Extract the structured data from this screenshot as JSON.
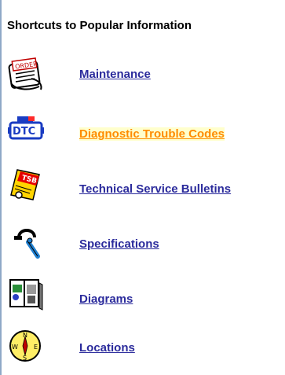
{
  "heading": "Shortcuts to Popular Information",
  "items": [
    {
      "label": "Maintenance",
      "icon": "order-clipboard-icon"
    },
    {
      "label": "Diagnostic Trouble Codes",
      "icon": "dtc-engine-icon"
    },
    {
      "label": "Technical Service Bulletins",
      "icon": "tsb-document-icon"
    },
    {
      "label": "Specifications",
      "icon": "caliper-wrench-icon"
    },
    {
      "label": "Diagrams",
      "icon": "diagram-book-icon"
    },
    {
      "label": "Locations",
      "icon": "compass-icon"
    }
  ],
  "colors": {
    "link": "#2b2b9c",
    "active_link": "#ff8c00",
    "active_highlight": "#ffffcc",
    "icon_outline": "#000000",
    "dtc_blue": "#1a3cc2",
    "dtc_red": "#ff2a2a",
    "tsb_red": "#e60000",
    "tsb_yellow": "#ffd400"
  }
}
